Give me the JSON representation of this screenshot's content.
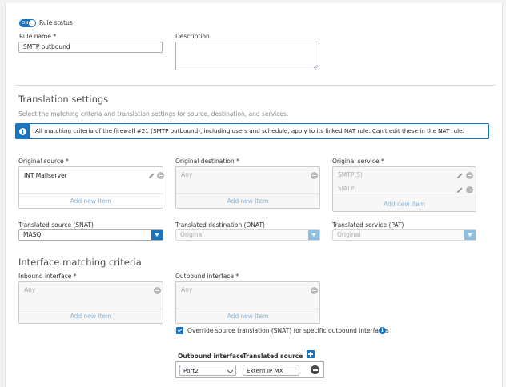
{
  "rule_status": {
    "toggle_text": "ON",
    "label": "Rule status"
  },
  "rule_name": {
    "label": "Rule name *",
    "value": "SMTP outbound"
  },
  "description": {
    "label": "Description"
  },
  "translation_settings": {
    "title": "Translation settings",
    "subtitle": "Select the matching criteria and translation settings for source, destination, and services.",
    "info_message": "All matching criteria of the firewall #21 (SMTP outbound), including users and schedule, apply to its linked NAT rule. Can't edit these in the NAT rule."
  },
  "original_source": {
    "label": "Original source *",
    "items": [
      "INT Mailserver"
    ],
    "add_label": "Add new item"
  },
  "original_destination": {
    "label": "Original destination *",
    "placeholder": "Any",
    "add_label": "Add new item"
  },
  "original_service": {
    "label": "Original service *",
    "items": [
      "SMTP(S)",
      "SMTP"
    ],
    "add_label": "Add new item"
  },
  "translated_source": {
    "label": "Translated source (SNAT)",
    "value": "MASQ"
  },
  "translated_destination": {
    "label": "Translated destination (DNAT)",
    "value": "Original"
  },
  "translated_service": {
    "label": "Translated service (PAT)",
    "value": "Original"
  },
  "interface_matching": {
    "title": "Interface matching criteria",
    "inbound": {
      "label": "Inbound interface *",
      "placeholder": "Any",
      "add_label": "Add new item"
    },
    "outbound": {
      "label": "Outbound interface *",
      "placeholder": "Any",
      "add_label": "Add new item"
    },
    "override_label": "Override source translation (SNAT) for specific outbound interfaces"
  },
  "override_table": {
    "col_outbound": "Outbound interface",
    "col_translated": "Translated source",
    "rows": [
      {
        "interface": "Port2",
        "source": "Extern IP   MX"
      }
    ]
  },
  "colors": {
    "accent": "#1a73bf",
    "disabled_accent": "#8ebee0",
    "link": "#8ab4d8"
  }
}
